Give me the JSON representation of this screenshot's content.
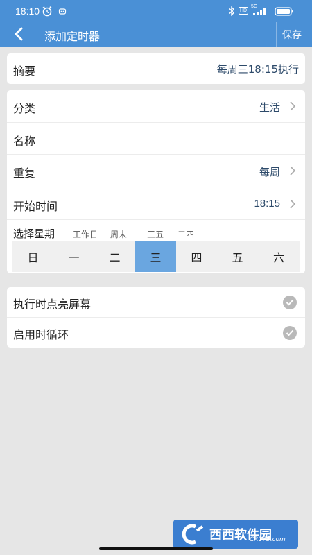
{
  "status_bar": {
    "time": "18:10",
    "net": "HD",
    "signal_label": "5G"
  },
  "app_bar": {
    "title": "添加定时器",
    "save_label": "保存"
  },
  "summary": {
    "label": "摘要",
    "value": "每周三18:15执行"
  },
  "form": {
    "category_label": "分类",
    "category_value": "生活",
    "name_label": "名称",
    "name_value": "",
    "repeat_label": "重复",
    "repeat_value": "每周",
    "start_time_label": "开始时间",
    "start_time_value": "18:15",
    "weekday_label": "选择星期",
    "weekday_presets": [
      "工作日",
      "周末",
      "一三五",
      "二四"
    ],
    "weekdays": [
      "日",
      "一",
      "二",
      "三",
      "四",
      "五",
      "六"
    ],
    "selected_weekday": "三"
  },
  "options": {
    "screen_on_label": "执行时点亮屏幕",
    "screen_on_checked": true,
    "loop_label": "启用时循环",
    "loop_checked": true
  },
  "watermark": {
    "text": "西西软件园",
    "sub": "CR173.com"
  },
  "colors": {
    "primary": "#4a90d6",
    "selected_day": "#6aa6e0",
    "background": "#e6e6e6",
    "value_text": "#2d4a6a",
    "check": "#b9b9b9"
  }
}
